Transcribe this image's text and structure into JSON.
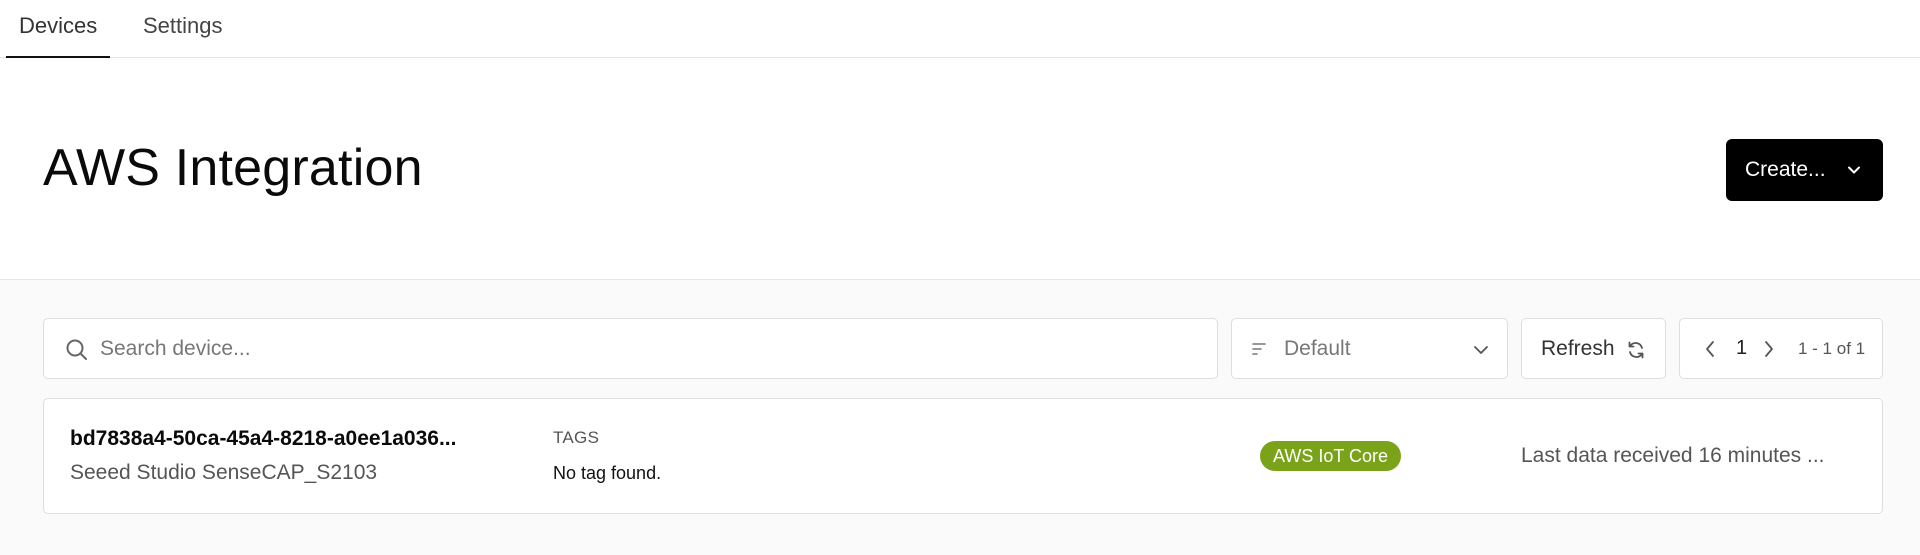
{
  "tabs": [
    {
      "label": "Devices",
      "active": true
    },
    {
      "label": "Settings",
      "active": false
    }
  ],
  "header": {
    "title": "AWS Integration",
    "create_label": "Create..."
  },
  "toolbar": {
    "search_placeholder": "Search device...",
    "sort_label": "Default",
    "refresh_label": "Refresh",
    "page_number": "1",
    "page_range": "1 - 1 of 1"
  },
  "devices": [
    {
      "id": "bd7838a4-50ca-45a4-8218-a0ee1a036...",
      "model": "Seeed Studio SenseCAP_S2103",
      "tags_heading": "TAGS",
      "tags_value": "No tag found.",
      "badge": "AWS IoT Core",
      "last_data": "Last data received 16 minutes ..."
    }
  ],
  "colors": {
    "badge": "#7aa31a",
    "primary_button": "#000000"
  }
}
